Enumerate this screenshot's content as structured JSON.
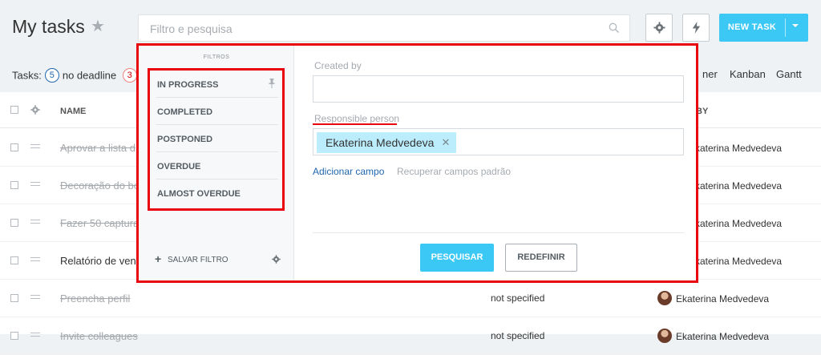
{
  "header": {
    "title": "My tasks",
    "search_placeholder": "Filtro e pesquisa",
    "new_task_label": "NEW TASK"
  },
  "counters": {
    "label": "Tasks:",
    "no_deadline_count": "5",
    "no_deadline_label": "no deadline",
    "overdue_count": "3"
  },
  "views": [
    "ner",
    "Kanban",
    "Gantt"
  ],
  "table": {
    "col_name": "NAME",
    "col_by": "BY",
    "rows": [
      {
        "name": "Aprovar a lista d",
        "responsible": "katerina Medvedeva",
        "deadline": ""
      },
      {
        "name": "Decoração do bo",
        "responsible": "katerina Medvedeva",
        "deadline": ""
      },
      {
        "name": "Fazer 50 captura",
        "responsible": "katerina Medvedeva",
        "deadline": ""
      },
      {
        "name": "Relatório de ven",
        "responsible": "katerina Medvedeva",
        "deadline": ""
      },
      {
        "name": "Preencha perfil",
        "responsible": "Ekaterina Medvedeva",
        "deadline": "not specified"
      },
      {
        "name": "Invite colleagues",
        "responsible": "Ekaterina Medvedeva",
        "deadline": "not specified"
      }
    ]
  },
  "filter_panel": {
    "title": "FILTROS",
    "presets": [
      "IN PROGRESS",
      "COMPLETED",
      "POSTPONED",
      "OVERDUE",
      "ALMOST OVERDUE"
    ],
    "save_filter": "SALVAR FILTRO",
    "created_by_label": "Created by",
    "created_by_value": "",
    "responsible_label": "Responsible person",
    "responsible_tag": "Ekaterina Medvedeva",
    "add_field": "Adicionar campo",
    "restore_fields": "Recuperar campos padrão",
    "search_button": "PESQUISAR",
    "reset_button": "REDEFINIR"
  },
  "colors": {
    "accent": "#3bc8f5",
    "highlight": "#e8050e",
    "link": "#2067b0"
  }
}
